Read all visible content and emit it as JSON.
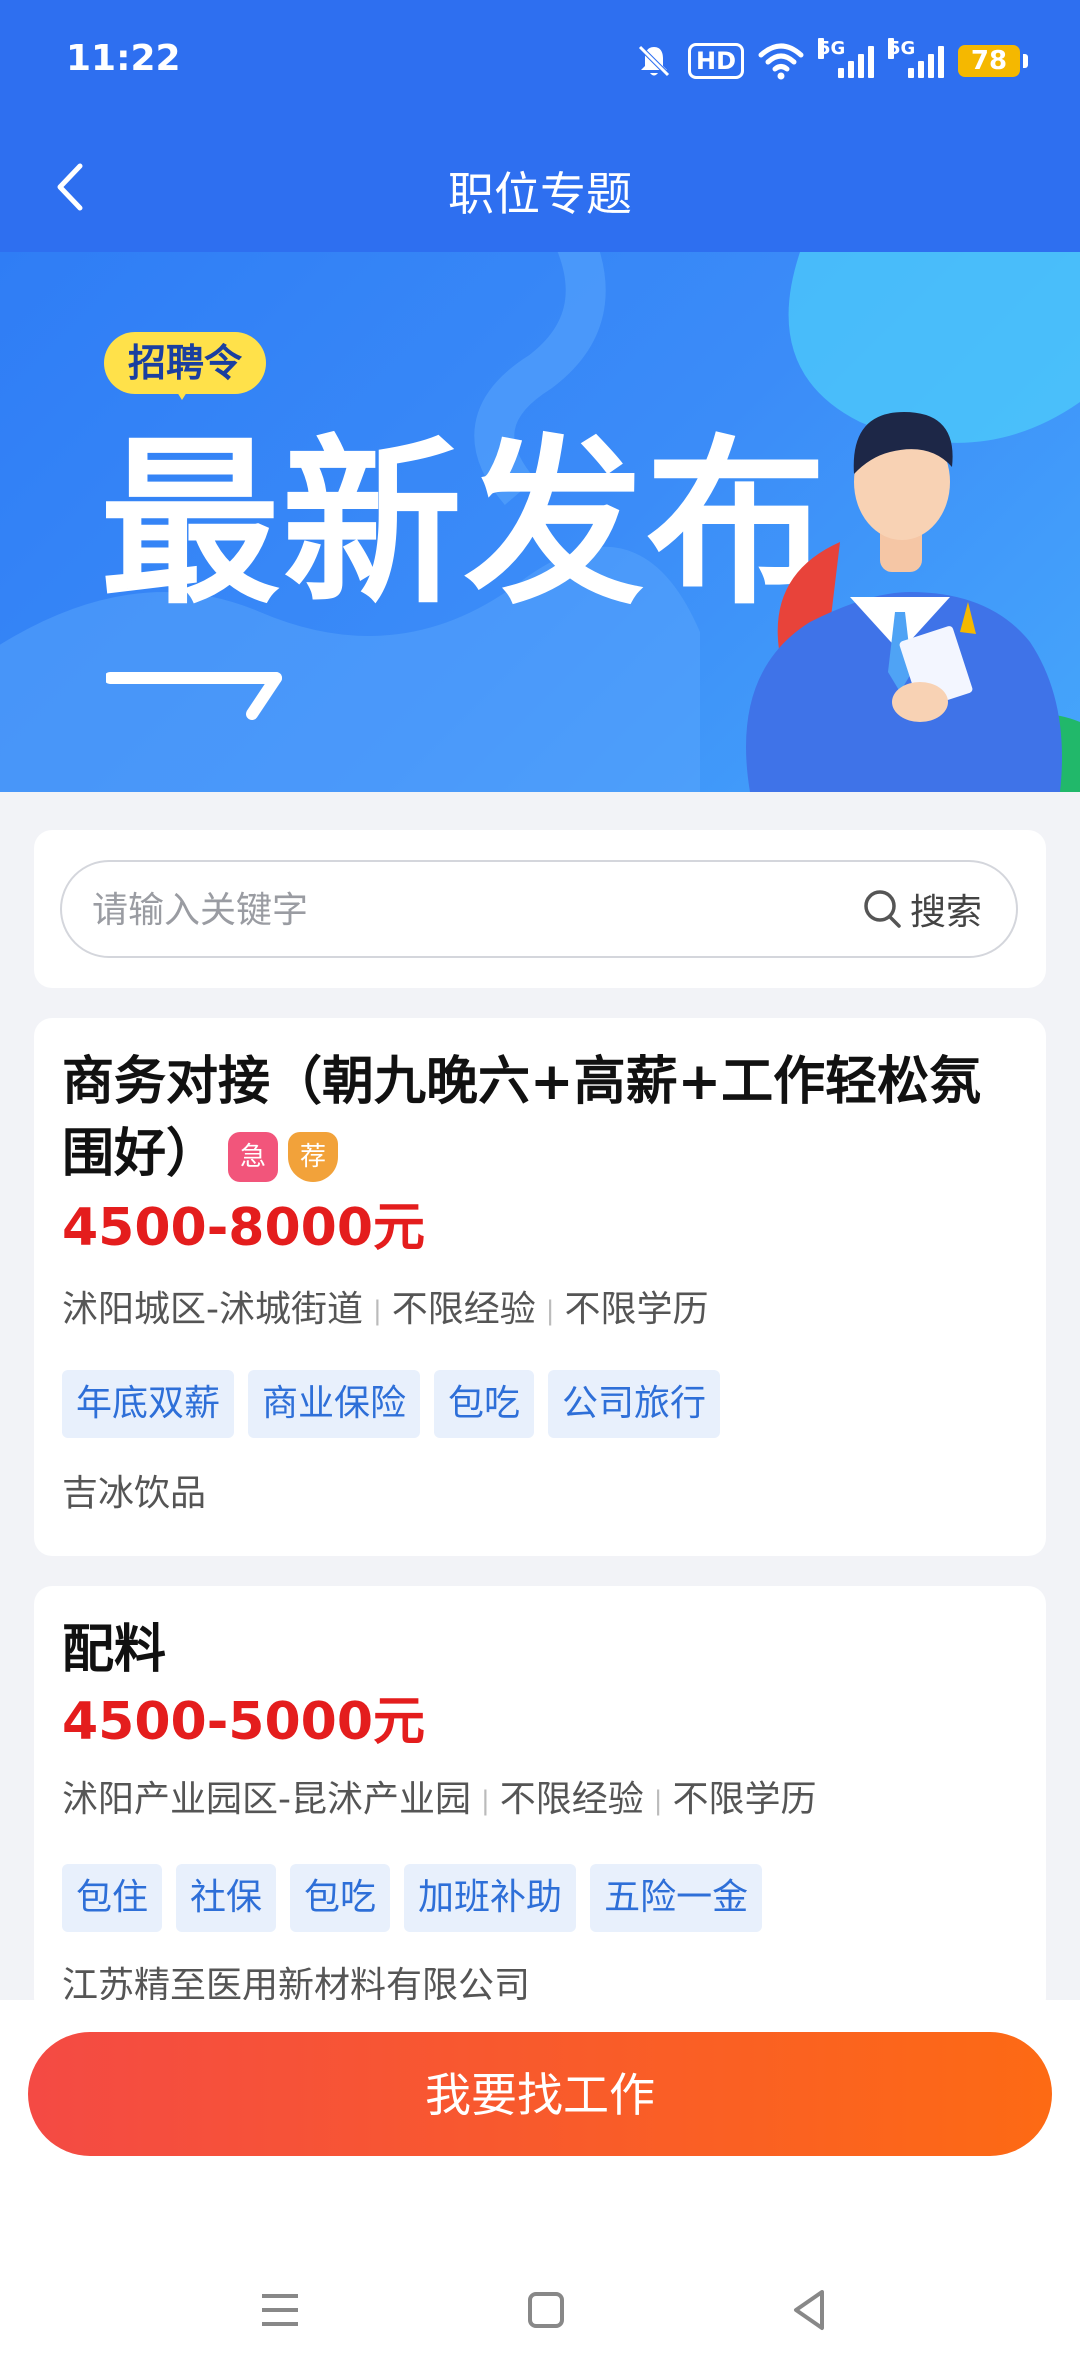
{
  "status_bar": {
    "time": "11:22",
    "hd_label": "HD",
    "network_5g_1": "5G",
    "network_5g_2": "5G",
    "battery": "78"
  },
  "header": {
    "title": "职位专题"
  },
  "banner": {
    "tag": "招聘令",
    "title": "最新发布"
  },
  "search": {
    "placeholder": "请输入关键字",
    "button_label": "搜索"
  },
  "jobs": [
    {
      "title": "商务对接（朝九晚六+高薪+工作轻松氛围好）",
      "badges": [
        "急",
        "荐"
      ],
      "salary": "4500-8000元",
      "location": "沭阳城区-沭城街道",
      "experience": "不限经验",
      "education": "不限学历",
      "tags": [
        "年底双薪",
        "商业保险",
        "包吃",
        "公司旅行"
      ],
      "company": "吉冰饮品"
    },
    {
      "title": "配料",
      "salary": "4500-5000元",
      "location": "沭阳产业园区-昆沭产业园",
      "experience": "不限经验",
      "education": "不限学历",
      "tags": [
        "包住",
        "社保",
        "包吃",
        "加班补助",
        "五险一金"
      ],
      "company": "江苏精至医用新材料有限公司"
    }
  ],
  "cta": {
    "label": "我要找工作"
  },
  "colors": {
    "primary_blue": "#2e6ff0",
    "salary_red": "#e41d1d",
    "cta_start": "#f44a44",
    "cta_end": "#fd6a14",
    "tag_text": "#2e6fd8"
  },
  "icons": [
    "back-arrow-icon",
    "search-icon",
    "mute-bell-icon",
    "wifi-icon",
    "signal-icon",
    "menu-icon",
    "home-square-icon",
    "back-triangle-icon"
  ]
}
